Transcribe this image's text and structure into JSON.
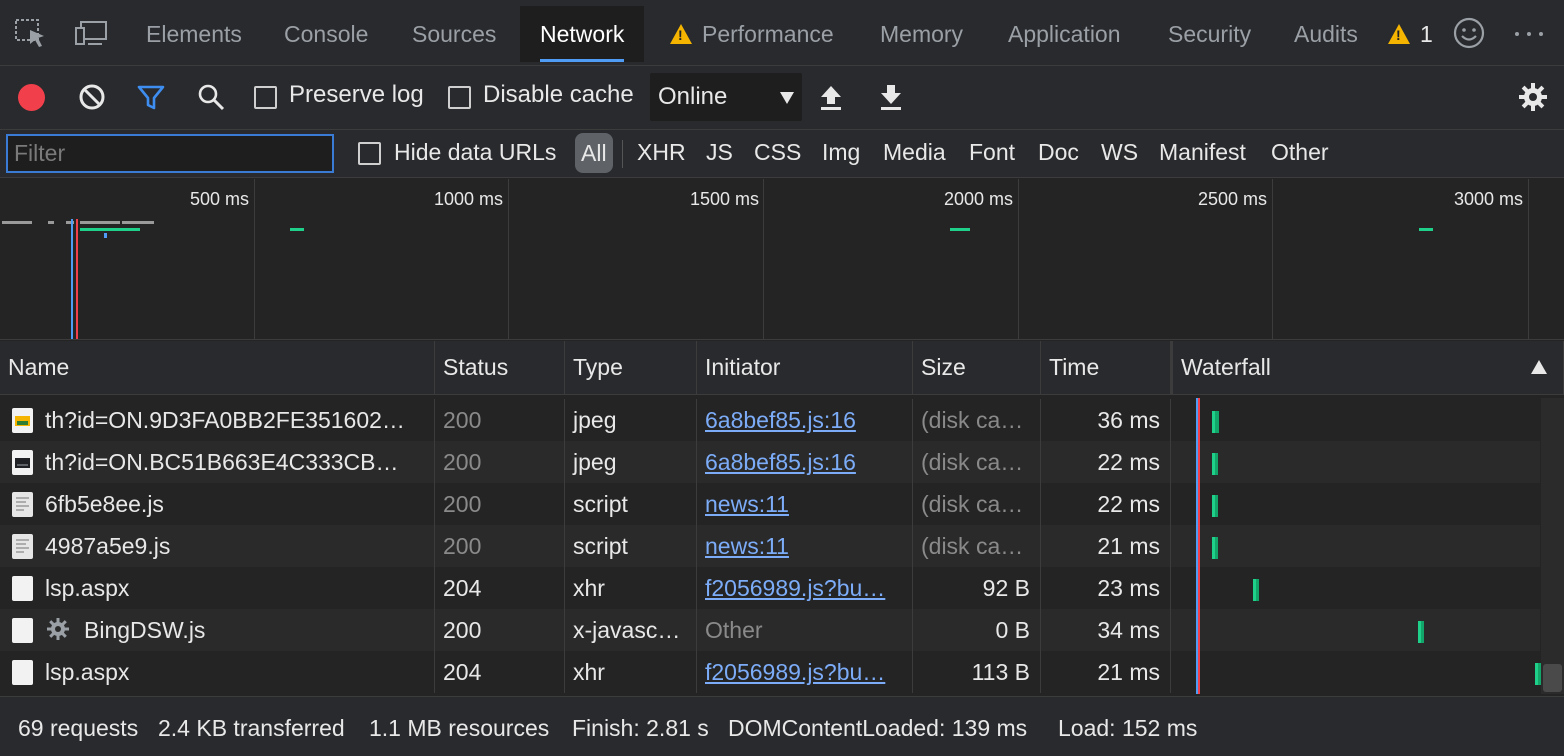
{
  "tabs": [
    {
      "label": "Elements"
    },
    {
      "label": "Console"
    },
    {
      "label": "Sources"
    },
    {
      "label": "Network",
      "active": true
    },
    {
      "label": "Performance",
      "warning": true
    },
    {
      "label": "Memory"
    },
    {
      "label": "Application"
    },
    {
      "label": "Security"
    },
    {
      "label": "Audits"
    }
  ],
  "warning_count": "1",
  "toolbar": {
    "preserve_log_label": "Preserve log",
    "disable_cache_label": "Disable cache",
    "throttle_value": "Online"
  },
  "filter": {
    "placeholder": "Filter",
    "hide_data_urls_label": "Hide data URLs",
    "types": [
      "All",
      "XHR",
      "JS",
      "CSS",
      "Img",
      "Media",
      "Font",
      "Doc",
      "WS",
      "Manifest",
      "Other"
    ]
  },
  "overview": {
    "ticks": [
      "500 ms",
      "1000 ms",
      "1500 ms",
      "2000 ms",
      "2500 ms",
      "3000 ms"
    ]
  },
  "columns": [
    "Name",
    "Status",
    "Type",
    "Initiator",
    "Size",
    "Time",
    "Waterfall"
  ],
  "rows": [
    {
      "name": "th?id=ON.9D3FA0BB2FE351602…",
      "status": "200",
      "type": "jpeg",
      "initiator": "6a8bef85.js:16",
      "size": "(disk ca…",
      "time": "36 ms",
      "icon": "image-icon"
    },
    {
      "name": "th?id=ON.BC51B663E4C333CB…",
      "status": "200",
      "type": "jpeg",
      "initiator": "6a8bef85.js:16",
      "size": "(disk ca…",
      "time": "22 ms",
      "icon": "image-icon"
    },
    {
      "name": "6fb5e8ee.js",
      "status": "200",
      "type": "script",
      "initiator": "news:11",
      "size": "(disk ca…",
      "time": "22 ms",
      "icon": "script-file-icon"
    },
    {
      "name": "4987a5e9.js",
      "status": "200",
      "type": "script",
      "initiator": "news:11",
      "size": "(disk ca…",
      "time": "21 ms",
      "icon": "script-file-icon"
    },
    {
      "name": "lsp.aspx",
      "status": "204",
      "type": "xhr",
      "initiator": "f2056989.js?bu…",
      "size": "92 B",
      "time": "23 ms",
      "icon": "blank-file-icon"
    },
    {
      "name": "BingDSW.js",
      "status": "200",
      "type": "x-javasc…",
      "initiator": "Other",
      "size": "0 B",
      "time": "34 ms",
      "icon": "blank-file-icon"
    },
    {
      "name": "lsp.aspx",
      "status": "204",
      "type": "xhr",
      "initiator": "f2056989.js?bu…",
      "size": "113 B",
      "time": "21 ms",
      "icon": "blank-file-icon"
    }
  ],
  "status_bar": {
    "requests": "69 requests",
    "transferred": "2.4 KB transferred",
    "resources": "1.1 MB resources",
    "finish": "Finish: 2.81 s",
    "dom_content_loaded": "DOMContentLoaded: 139 ms",
    "load": "Load: 152 ms"
  },
  "colors": {
    "record": "#f1404b",
    "active_tab_underline": "#4f9cf5",
    "link": "#7cacf8",
    "waterfall_bar": "#1fd08a",
    "dcl_line": "#4f9cf5",
    "load_line": "#f1404b"
  }
}
